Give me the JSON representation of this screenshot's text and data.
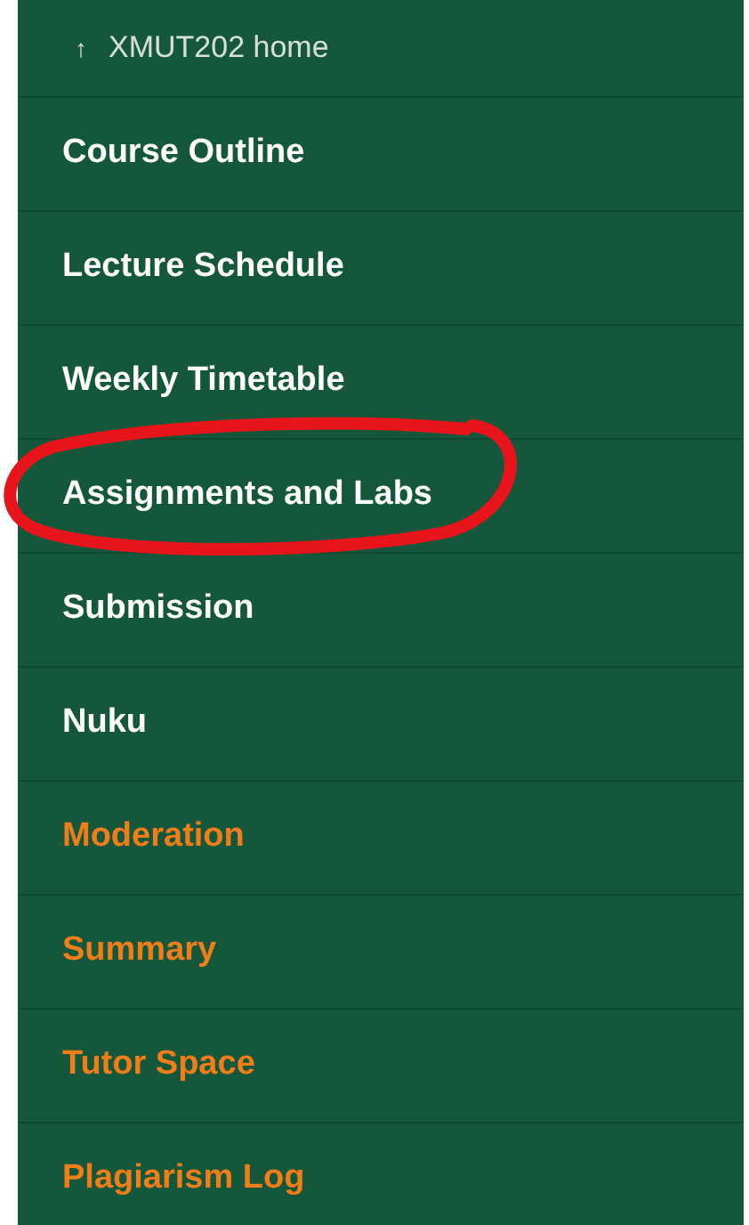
{
  "back_link": {
    "arrow": "↑",
    "label": "XMUT202 home"
  },
  "menu": [
    {
      "label": "Course Outline",
      "kind": "page",
      "circled": false
    },
    {
      "label": "Lecture Schedule",
      "kind": "page",
      "circled": false
    },
    {
      "label": "Weekly Timetable",
      "kind": "page",
      "circled": false
    },
    {
      "label": "Assignments and Labs",
      "kind": "page",
      "circled": true
    },
    {
      "label": "Submission",
      "kind": "page",
      "circled": false
    },
    {
      "label": "Nuku",
      "kind": "page",
      "circled": false
    },
    {
      "label": "Moderation",
      "kind": "staff",
      "circled": false
    },
    {
      "label": "Summary",
      "kind": "staff",
      "circled": false
    },
    {
      "label": "Tutor Space",
      "kind": "staff",
      "circled": false
    },
    {
      "label": "Plagiarism Log",
      "kind": "staff",
      "circled": false
    }
  ]
}
